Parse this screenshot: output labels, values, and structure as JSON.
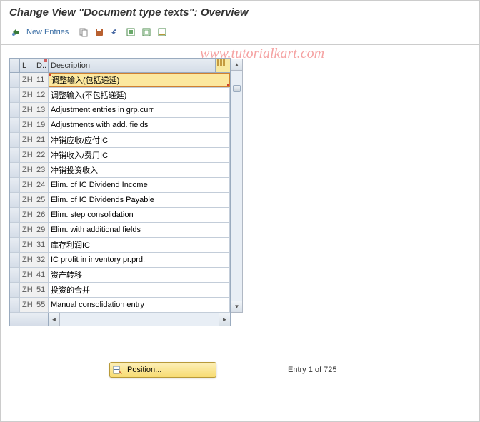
{
  "title": "Change View \"Document type texts\": Overview",
  "toolbar": {
    "new_entries": "New Entries"
  },
  "watermark": "www.tutorialkart.com",
  "table": {
    "headers": {
      "sel": "",
      "l": "L",
      "d": "D..",
      "desc": "Description"
    },
    "rows": [
      {
        "l": "ZH",
        "d": "11",
        "desc": "调整输入(包括递延)",
        "selected": true
      },
      {
        "l": "ZH",
        "d": "12",
        "desc": "调整输入(不包括递延)"
      },
      {
        "l": "ZH",
        "d": "13",
        "desc": "Adjustment entries in grp.curr"
      },
      {
        "l": "ZH",
        "d": "19",
        "desc": "Adjustments with add. fields"
      },
      {
        "l": "ZH",
        "d": "21",
        "desc": "冲销应收/应付IC"
      },
      {
        "l": "ZH",
        "d": "22",
        "desc": "冲销收入/费用IC"
      },
      {
        "l": "ZH",
        "d": "23",
        "desc": "冲销投资收入"
      },
      {
        "l": "ZH",
        "d": "24",
        "desc": "Elim. of IC Dividend Income"
      },
      {
        "l": "ZH",
        "d": "25",
        "desc": "Elim. of IC Dividends Payable"
      },
      {
        "l": "ZH",
        "d": "26",
        "desc": "Elim. step consolidation"
      },
      {
        "l": "ZH",
        "d": "29",
        "desc": "Elim. with additional fields"
      },
      {
        "l": "ZH",
        "d": "31",
        "desc": "库存利润IC"
      },
      {
        "l": "ZH",
        "d": "32",
        "desc": "IC profit in inventory pr.prd."
      },
      {
        "l": "ZH",
        "d": "41",
        "desc": "资产转移"
      },
      {
        "l": "ZH",
        "d": "51",
        "desc": "投资的合并"
      },
      {
        "l": "ZH",
        "d": "55",
        "desc": "Manual consolidation entry"
      }
    ]
  },
  "footer": {
    "position_label": "Position...",
    "entry_info": "Entry 1 of 725"
  }
}
